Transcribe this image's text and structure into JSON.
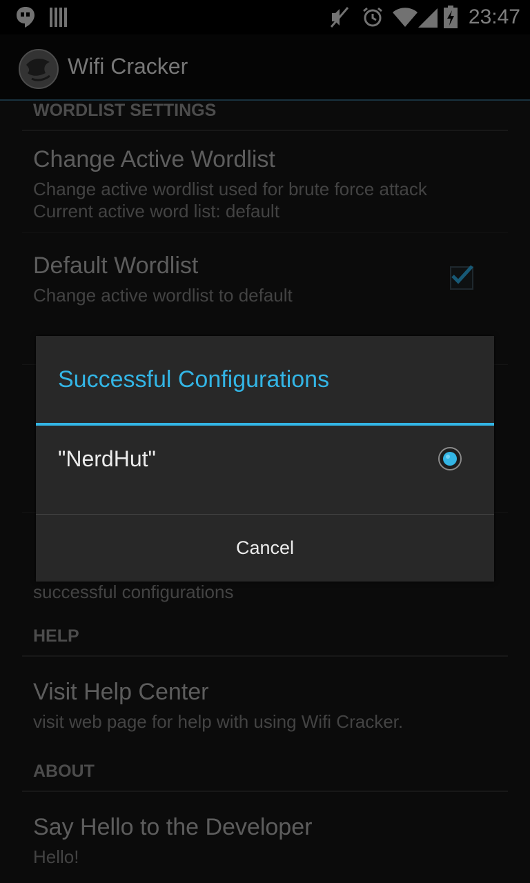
{
  "status_bar": {
    "time": "23:47"
  },
  "app": {
    "title": "Wifi Cracker"
  },
  "settings": {
    "wordlist_header": "WORDLIST SETTINGS",
    "change_wordlist_title": "Change Active Wordlist",
    "change_wordlist_summary_1": "Change active wordlist used for brute force attack",
    "change_wordlist_summary_2": "Current active word list: default",
    "default_wordlist_title": "Default Wordlist",
    "default_wordlist_summary": "Change active wordlist to default",
    "partial_summary": "successful configurations",
    "help_header": "HELP",
    "help_center_title": "Visit Help Center",
    "help_center_summary": "visit web page for help with using Wifi Cracker.",
    "about_header": "ABOUT",
    "developer_title": "Say Hello to the Developer",
    "developer_summary": "Hello!"
  },
  "dialog": {
    "title": "Successful Configurations",
    "items": [
      {
        "label": "\"NerdHut\"",
        "selected": true
      }
    ],
    "cancel_label": "Cancel"
  },
  "colors": {
    "accent": "#33b5e5"
  }
}
